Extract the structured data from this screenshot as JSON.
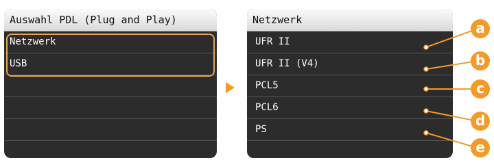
{
  "left_panel": {
    "title": "Auswahl PDL (Plug and Play)",
    "items": [
      "Netzwerk",
      "USB"
    ]
  },
  "right_panel": {
    "title": "Netzwerk",
    "items": [
      "UFR II",
      "UFR II (V4)",
      "PCL5",
      "PCL6",
      "PS"
    ]
  },
  "callouts": [
    "a",
    "b",
    "c",
    "d",
    "e"
  ],
  "colors": {
    "accent": "#f39b28",
    "highlight": "#e9a44e",
    "screen": "#2c2c2c"
  }
}
